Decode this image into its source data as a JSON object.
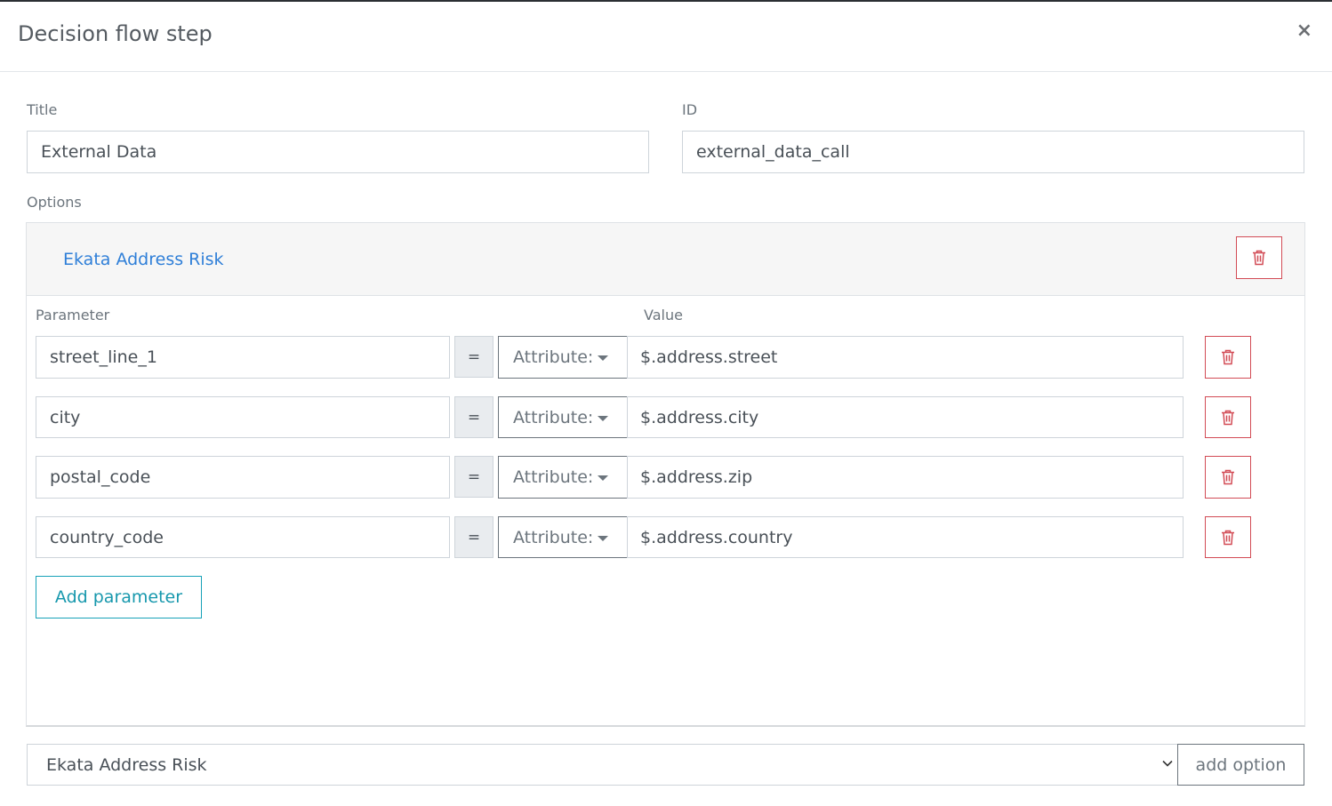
{
  "modal": {
    "title": "Decision flow step",
    "close_label": "×"
  },
  "form": {
    "title_label": "Title",
    "title_value": "External Data",
    "id_label": "ID",
    "id_value": "external_data_call",
    "options_label": "Options"
  },
  "option_card": {
    "name": "Ekata Address Risk",
    "parameter_header": "Parameter",
    "value_header": "Value",
    "parameters": [
      {
        "name": "street_line_1",
        "operator": "=",
        "type": "Attribute:",
        "value": "$.address.street"
      },
      {
        "name": "city",
        "operator": "=",
        "type": "Attribute:",
        "value": "$.address.city"
      },
      {
        "name": "postal_code",
        "operator": "=",
        "type": "Attribute:",
        "value": "$.address.zip"
      },
      {
        "name": "country_code",
        "operator": "=",
        "type": "Attribute:",
        "value": "$.address.country"
      }
    ],
    "add_parameter_label": "Add parameter"
  },
  "footer": {
    "selected_option": "Ekata Address Risk",
    "add_option_label": "add option"
  },
  "colors": {
    "danger": "#d24b55",
    "link": "#2f7fd8",
    "info": "#17a2b8"
  }
}
